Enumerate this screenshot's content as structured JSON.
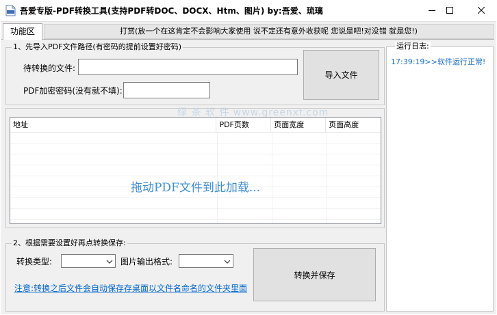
{
  "window": {
    "title": "吾爱专版-PDF转换工具(支持PDF转DOC、DOCX、Htm、图片)  by:吾爱、琉璃",
    "minimize_icon": "minimize-icon",
    "maximize_icon": "maximize-icon",
    "close_icon": "close-icon"
  },
  "tabs": {
    "active": "功能区",
    "donate": "打赏(放一个在这肯定不会影响大家使用 说不定还有意外收获呢 您说是吧!对没错 就是您!)"
  },
  "import_group": {
    "title": "1、先导入PDF文件路径(有密码的提前设置好密码)",
    "file_label": "待转换的文件:",
    "file_value": "",
    "password_label": "PDF加密密码(没有就不填):",
    "password_value": "",
    "import_button": "导入文件"
  },
  "file_list": {
    "columns": [
      "地址",
      "PDF页数",
      "页面宽度",
      "页面高度"
    ],
    "rows": [],
    "drop_hint": "拖动PDF文件到此加载..."
  },
  "watermark": "绿 茶 软 件  www.greenxf.com",
  "convert_group": {
    "title": "2、根据需要设置好再点转换保存:",
    "type_label": "转换类型:",
    "type_value": "",
    "image_format_label": "图片输出格式:",
    "image_format_value": "",
    "note": "注意:转换之后文件会自动保存存桌面以文件名命名的文件夹里面",
    "convert_button": "转换并保存"
  },
  "log": {
    "title": "运行日志:",
    "lines": [
      "17:39:19>>软件运行正常!"
    ]
  },
  "colors": {
    "accent_blue": "#3d8fd6",
    "link_blue": "#0066cc",
    "log_blue": "#1a6ec7",
    "client_bg": "#f0f0f0"
  }
}
